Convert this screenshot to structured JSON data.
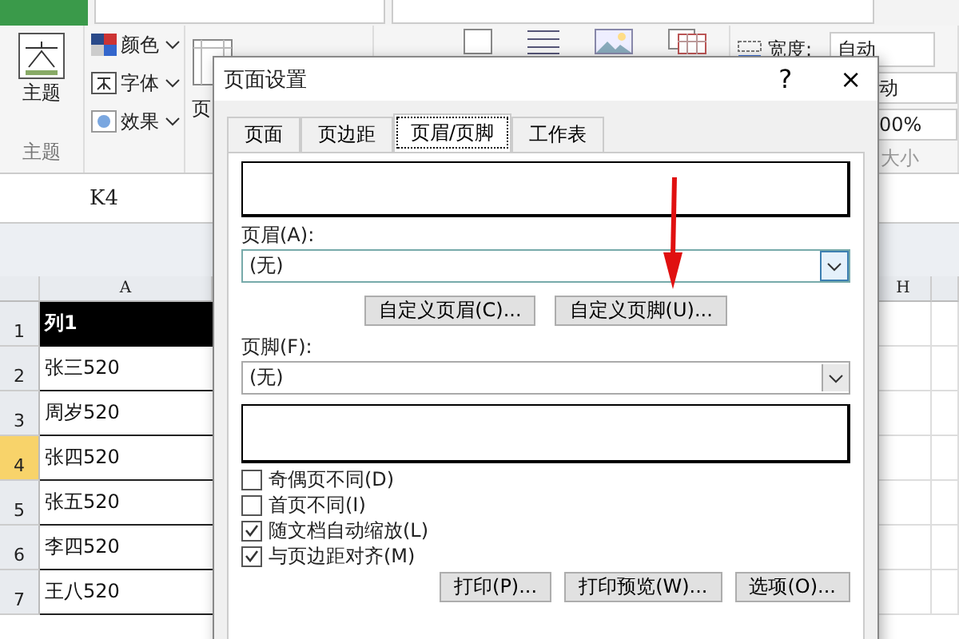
{
  "ribbon": {
    "theme_button": "主题",
    "theme_items": [
      {
        "label": "颜色",
        "kind": "colors"
      },
      {
        "label": "字体",
        "kind": "fonts"
      },
      {
        "label": "效果",
        "kind": "effects"
      }
    ],
    "group_label": "主题",
    "partial_label": "页",
    "width_label": "宽度:",
    "width_value": "自动",
    "height_value": "动",
    "scale_value": "00%",
    "size_group_label": "大小"
  },
  "name_box": "K4",
  "sheet": {
    "columns": [
      "A",
      "H"
    ],
    "rows": [
      {
        "number": "1",
        "value": "列1",
        "kind": "header",
        "selected": false
      },
      {
        "number": "2",
        "value": "张三520",
        "kind": "data",
        "selected": false
      },
      {
        "number": "3",
        "value": "周岁520",
        "kind": "data",
        "selected": false
      },
      {
        "number": "4",
        "value": "张四520",
        "kind": "data",
        "selected": true
      },
      {
        "number": "5",
        "value": "张五520",
        "kind": "data",
        "selected": false
      },
      {
        "number": "6",
        "value": "李四520",
        "kind": "data",
        "selected": false
      },
      {
        "number": "7",
        "value": "王八520",
        "kind": "data",
        "selected": false
      }
    ]
  },
  "dialog": {
    "title": "页面设置",
    "help": "?",
    "close": "×",
    "tabs": [
      {
        "label": "页面",
        "selected": false
      },
      {
        "label": "页边距",
        "selected": false
      },
      {
        "label": "页眉/页脚",
        "selected": true
      },
      {
        "label": "工作表",
        "selected": false
      }
    ],
    "header_label": "页眉(A):",
    "header_value": "(无)",
    "custom_buttons": [
      "自定义页眉(C)...",
      "自定义页脚(U)..."
    ],
    "footer_label": "页脚(F):",
    "footer_value": "(无)",
    "options": [
      {
        "label": "奇偶页不同(D)",
        "checked": false
      },
      {
        "label": "首页不同(I)",
        "checked": false
      },
      {
        "label": "随文档自动缩放(L)",
        "checked": true
      },
      {
        "label": "与页边距对齐(M)",
        "checked": true
      }
    ],
    "buttons": [
      "打印(P)...",
      "打印预览(W)...",
      "选项(O)..."
    ]
  }
}
